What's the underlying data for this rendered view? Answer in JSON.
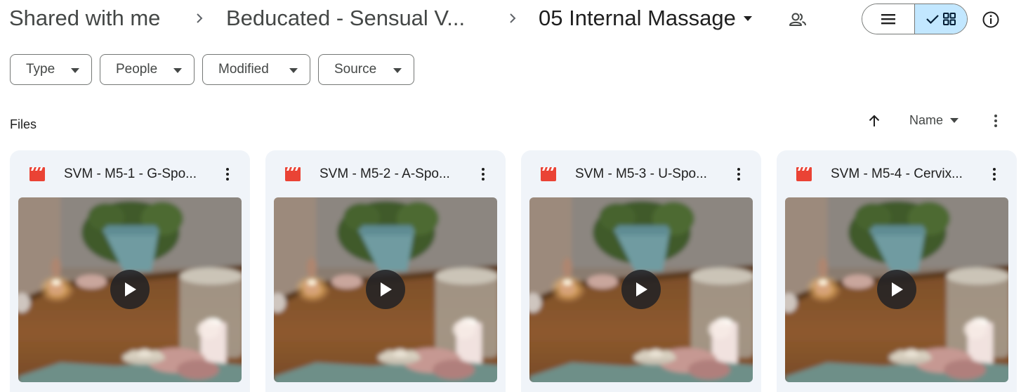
{
  "breadcrumb": {
    "root": "Shared with me",
    "parent": "Beducated - Sensual V...",
    "current": "05 Internal Massage"
  },
  "icons": {
    "separator": "chevron-right-icon",
    "folder_menu": "caret-down-icon",
    "shared": "people-icon",
    "list_view": "list-view-icon",
    "grid_view": "grid-view-icon",
    "info": "info-icon",
    "file_type": "video-file-icon",
    "more": "more-vert-icon",
    "play": "play-icon"
  },
  "view": {
    "selected": "grid"
  },
  "filters": [
    {
      "label": "Type"
    },
    {
      "label": "People"
    },
    {
      "label": "Modified"
    },
    {
      "label": "Source"
    }
  ],
  "files_section": {
    "title": "Files",
    "sort_label": "Name",
    "sort_direction": "ascending"
  },
  "files": [
    {
      "name": "SVM - M5-1 - G-Spo..."
    },
    {
      "name": "SVM - M5-2 - A-Spo..."
    },
    {
      "name": "SVM - M5-3 - U-Spo..."
    },
    {
      "name": "SVM - M5-4 - Cervix..."
    }
  ],
  "colors": {
    "accent_selected": "#c2e7ff",
    "video_icon": "#ea4335",
    "card_bg": "#f0f4f9"
  }
}
